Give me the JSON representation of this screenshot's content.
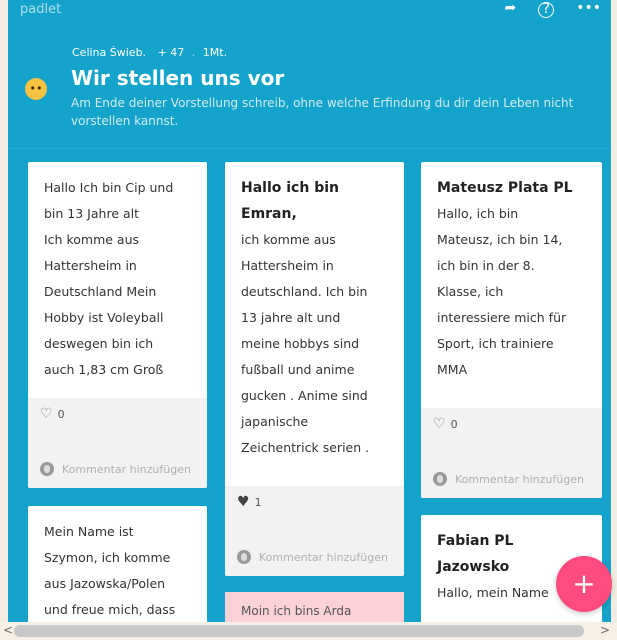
{
  "app": {
    "brand": "padlet",
    "share_icon": "share-arrow-icon",
    "help_label": "?",
    "more_label": "•••"
  },
  "header": {
    "author": "Celina Świeb.",
    "plus": "+ 47",
    "dot": ".",
    "age": "1Mt.",
    "title": "Wir stellen uns vor",
    "description": "Am Ende deiner Vorstellung schreib, ohne welche Erfindung du dir dein Leben nicht vorstellen kannst."
  },
  "colors": {
    "accent": "#14a3cb",
    "fab": "#ff4b7d"
  },
  "cards": [
    {
      "lines": [
        "Hallo Ich bin Cip und",
        "bin 13 Jahre alt",
        "Ich komme aus",
        "Hattersheim in",
        "Deutschland Mein",
        "Hobby ist Voleyball",
        "deswegen bin ich",
        "auch 1,83 cm Groß"
      ],
      "likes": "0",
      "comment_placeholder": "Kommentar hinzufügen"
    },
    {
      "title_lines": [
        "Hallo ich bin",
        "Emran,"
      ],
      "lines": [
        "ich komme aus",
        "Hattersheim in",
        "deutschland. Ich bin",
        "13 jahre alt und",
        "meine hobbys sind",
        "fußball und anime",
        "gucken . Anime sind",
        "japanische",
        "Zeichentrick serien ."
      ],
      "likes": "1",
      "comment_placeholder": "Kommentar hinzufügen"
    },
    {
      "title_lines": [
        "Mateusz Plata PL"
      ],
      "lines": [
        "Hallo, ich bin",
        "Mateusz, ich bin 14,",
        "ich bin in der 8.",
        "Klasse, ich",
        "interessiere mich für",
        "Sport, ich trainiere",
        "MMA"
      ],
      "likes": "0",
      "comment_placeholder": "Kommentar hinzufügen"
    },
    {
      "lines": [
        "Mein Name ist",
        "Szymon, ich komme",
        "aus Jazowska/Polen",
        "und freue mich, dass"
      ]
    },
    {
      "title_lines": [
        "Fabian PL",
        "Jazowsko"
      ],
      "lines": [
        "Hallo, mein Name"
      ]
    },
    {
      "lines": [
        "Moin ich bins Arda"
      ]
    }
  ],
  "fab": {
    "label": "+"
  },
  "scroll": {
    "left": "<",
    "right": ">"
  }
}
